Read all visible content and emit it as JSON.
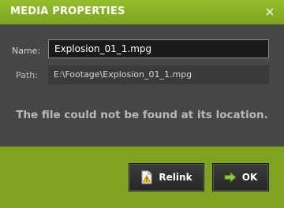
{
  "dialog": {
    "title": "MEDIA PROPERTIES",
    "close_icon": "close-icon"
  },
  "form": {
    "name_label": "Name:",
    "name_value": "Explosion_01_1.mpg",
    "path_label": "Path:",
    "path_value": "E:\\Footage\\Explosion_01_1.mpg"
  },
  "message": "The file could not be found at its location.",
  "buttons": {
    "relink_label": "Relink",
    "relink_icon": "warning-document-icon",
    "ok_label": "OK",
    "ok_icon": "arrow-right-icon"
  },
  "colors": {
    "accent_green": "#80a31f",
    "panel_gray": "#464646",
    "message_gray": "#b9b9b9"
  }
}
